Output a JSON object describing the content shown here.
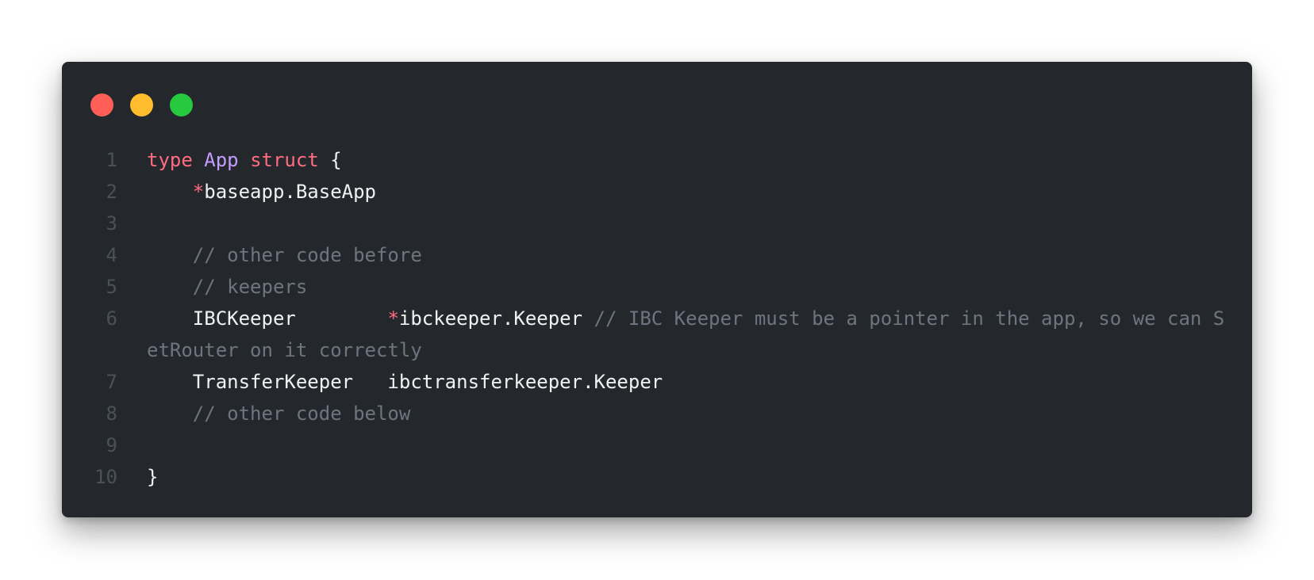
{
  "window": {
    "buttons": [
      {
        "name": "close",
        "color": "#ff5f56"
      },
      {
        "name": "minimize",
        "color": "#ffbd2e"
      },
      {
        "name": "zoom",
        "color": "#27c93f"
      }
    ]
  },
  "code": {
    "lines": [
      {
        "n": "1",
        "parts": [
          {
            "t": "type",
            "c": "kw"
          },
          {
            "t": " ",
            "c": "plain"
          },
          {
            "t": "App",
            "c": "type"
          },
          {
            "t": " ",
            "c": "plain"
          },
          {
            "t": "struct",
            "c": "kw"
          },
          {
            "t": " {",
            "c": "plain"
          }
        ]
      },
      {
        "n": "2",
        "parts": [
          {
            "t": "    ",
            "c": "plain"
          },
          {
            "t": "*",
            "c": "kw"
          },
          {
            "t": "baseapp.BaseApp",
            "c": "plain"
          }
        ]
      },
      {
        "n": "3",
        "parts": []
      },
      {
        "n": "4",
        "parts": [
          {
            "t": "    ",
            "c": "plain"
          },
          {
            "t": "// other code before",
            "c": "cmt"
          }
        ]
      },
      {
        "n": "5",
        "parts": [
          {
            "t": "    ",
            "c": "plain"
          },
          {
            "t": "// keepers",
            "c": "cmt"
          }
        ]
      },
      {
        "n": "6",
        "wrap": true,
        "parts": [
          {
            "t": "    IBCKeeper        ",
            "c": "plain"
          },
          {
            "t": "*",
            "c": "kw"
          },
          {
            "t": "ibckeeper.Keeper",
            "c": "plain"
          },
          {
            "t": " // IBC Keeper must be a pointer in the app, so we can SetRouter on it correctly",
            "c": "cmt"
          }
        ]
      },
      {
        "n": "7",
        "parts": [
          {
            "t": "    TransferKeeper   ibctransferkeeper.Keeper",
            "c": "plain"
          }
        ]
      },
      {
        "n": "8",
        "parts": [
          {
            "t": "    ",
            "c": "plain"
          },
          {
            "t": "// other code below",
            "c": "cmt"
          }
        ]
      },
      {
        "n": "9",
        "parts": []
      },
      {
        "n": "10",
        "parts": [
          {
            "t": "}",
            "c": "plain"
          }
        ]
      }
    ]
  }
}
